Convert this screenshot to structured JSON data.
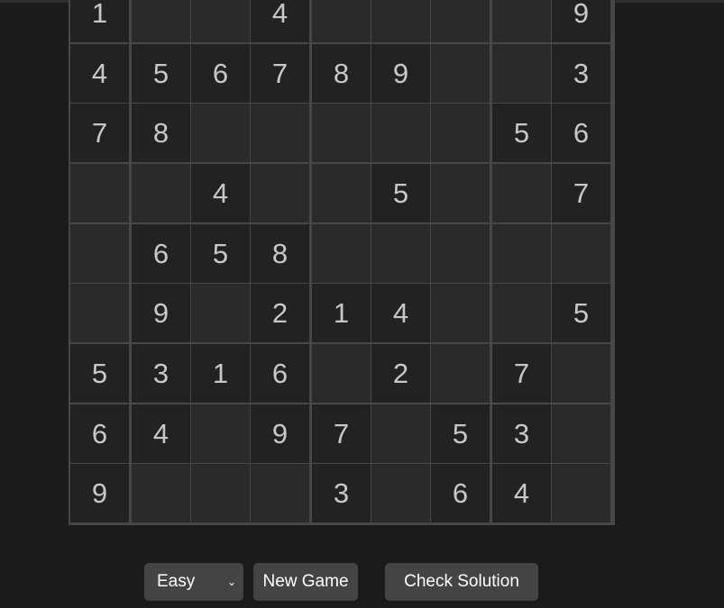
{
  "board": {
    "rows": [
      [
        1,
        0,
        0,
        4,
        0,
        0,
        0,
        0,
        9
      ],
      [
        4,
        5,
        6,
        7,
        8,
        9,
        0,
        0,
        3
      ],
      [
        7,
        8,
        0,
        0,
        0,
        0,
        0,
        5,
        6
      ],
      [
        0,
        0,
        4,
        0,
        0,
        5,
        0,
        0,
        7
      ],
      [
        0,
        6,
        5,
        8,
        0,
        0,
        0,
        0,
        0
      ],
      [
        0,
        9,
        0,
        2,
        1,
        4,
        0,
        0,
        5
      ],
      [
        5,
        3,
        1,
        6,
        0,
        2,
        0,
        7,
        0
      ],
      [
        6,
        4,
        0,
        9,
        7,
        0,
        5,
        3,
        0
      ],
      [
        9,
        0,
        0,
        0,
        3,
        0,
        6,
        4,
        0
      ]
    ]
  },
  "controls": {
    "difficulty": "Easy",
    "new_game": "New Game",
    "check_solution": "Check Solution"
  },
  "colors": {
    "given_cell": "#222222",
    "empty_cell": "#2a2a2a",
    "grid_line": "#474747",
    "button": "#444444"
  }
}
